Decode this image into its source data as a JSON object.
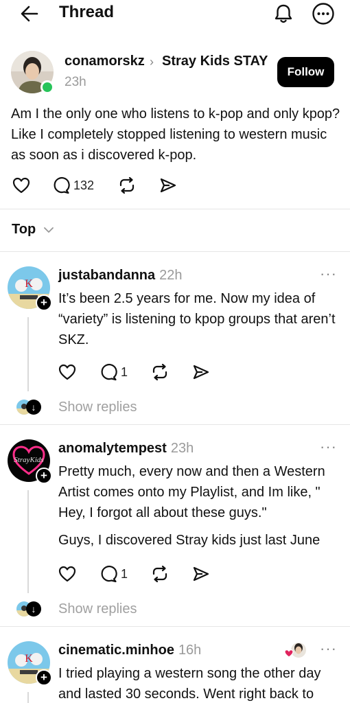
{
  "header": {
    "title": "Thread",
    "back_icon": "arrow-left-icon",
    "notification_icon": "bell-icon",
    "more_icon": "more-circle-icon"
  },
  "post": {
    "username": "conamorskz",
    "community": "Stray Kids STAY",
    "time": "23h",
    "follow_label": "Follow",
    "body": "Am I the only one who listens to k-pop and only kpop? Like I completely stopped listening to western music as soon as i discovered k-pop.",
    "reply_count": "132",
    "online_color": "#27c45a"
  },
  "sort": {
    "label": "Top"
  },
  "replies": [
    {
      "username": "justabandanna",
      "time": "22h",
      "body": "It’s been 2.5 years for me. Now my idea of “variety” is listening to kpop groups that aren’t SKZ.",
      "reply_count": "1",
      "show_replies": "Show replies"
    },
    {
      "username": "anomalytempest",
      "time": "23h",
      "body": "Pretty much, every now and then a Western Artist comes onto my Playlist, and Im like, \" Hey, I forgot all about these guys.\"",
      "body2": "Guys, I discovered Stray kids just last June",
      "reply_count": "1",
      "show_replies": "Show replies"
    },
    {
      "username": "cinematic.minhoe",
      "time": "16h",
      "body": "I tried playing a western song the other day and lasted 30 seconds. Went right back to"
    }
  ],
  "colors": {
    "accent": "#000000",
    "muted": "#9a9a9a",
    "like_heart": "#e0245e"
  }
}
